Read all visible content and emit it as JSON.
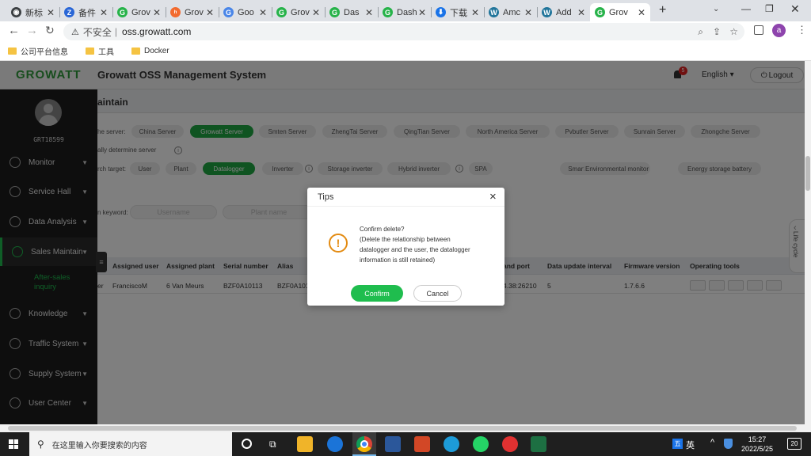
{
  "browser": {
    "tabs": [
      {
        "label": "新标",
        "color": "#3c4043",
        "glyph": "◉"
      },
      {
        "label": "备件",
        "color": "#2966d6",
        "glyph": "Z"
      },
      {
        "label": "Grov",
        "color": "#27b34a",
        "glyph": "G"
      },
      {
        "label": "Grov",
        "color": "#f26a2e",
        "glyph": "ʰ"
      },
      {
        "label": "Goo",
        "color": "#4a86e8",
        "glyph": "G"
      },
      {
        "label": "Grov",
        "color": "#27b34a",
        "glyph": "G"
      },
      {
        "label": "Das",
        "color": "#27b34a",
        "glyph": "G"
      },
      {
        "label": "Dash",
        "color": "#27b34a",
        "glyph": "G"
      },
      {
        "label": "下载",
        "color": "#1a73e8",
        "glyph": "⬇"
      },
      {
        "label": "Amc",
        "color": "#21759b",
        "glyph": "W"
      },
      {
        "label": "Add",
        "color": "#21759b",
        "glyph": "W"
      },
      {
        "label": "Grov",
        "color": "#27b34a",
        "glyph": "G"
      }
    ],
    "new_tab": "+",
    "security_label": "不安全",
    "url": "oss.growatt.com",
    "profile_initial": "a",
    "bookmarks": [
      "公司平台信息",
      "工具",
      "Docker"
    ]
  },
  "app": {
    "logo": "GROWATT",
    "title": "Growatt OSS Management System",
    "notification_count": "5",
    "language": "English",
    "logout": "Logout",
    "username": "GRT18599",
    "side_tab": "Life cycle"
  },
  "sidebar": {
    "items": [
      {
        "label": "Monitor",
        "caret": true
      },
      {
        "label": "Service Hall",
        "caret": true
      },
      {
        "label": "Data Analysis",
        "caret": true
      },
      {
        "label": "Sales Maintain",
        "caret": true
      },
      {
        "label": "Knowledge",
        "caret": true
      },
      {
        "label": "Traffic System",
        "caret": true
      },
      {
        "label": "Supply System",
        "caret": true
      },
      {
        "label": "User Center",
        "caret": true
      }
    ],
    "sub_item": "After-sales inquiry"
  },
  "page": {
    "title": "aintain",
    "server_label": "he server:",
    "servers": [
      "China Server",
      "Growatt Server",
      "Smten Server",
      "ZhengTai Server",
      "QingTian Server",
      "North America Server",
      "Pvbutler Server",
      "Sunrain Server",
      "Zhongche Server"
    ],
    "auto_server": "ally determine server",
    "target_label": "rch target:",
    "targets": [
      "User",
      "Plant",
      "Datalogger",
      "Inverter",
      "Storage inverter",
      "Hybrid inverter",
      "SPA",
      "Smart electric meter",
      "Environmental monitor",
      "Energy storage battery"
    ],
    "keyword_label": "n keyword:",
    "username_placeholder": "Username",
    "plant_placeholder": "Plant name",
    "table": {
      "headers": [
        "Assigned user",
        "Assigned plant",
        "Serial number",
        "Alias",
        "and port",
        "Data update interval",
        "Firmware version",
        "Operating tools"
      ],
      "row": [
        "er",
        "FranciscoM",
        "6 Van Meurs",
        "BZF0A10113",
        "BZF0A101",
        "4.38:26210",
        "5",
        "1.7.6.6"
      ]
    }
  },
  "dialog": {
    "title": "Tips",
    "close": "×",
    "message": [
      "Confirm delete?",
      "(Delete the relationship between",
      "datalogger and the user, the datalogger",
      "information is still retained)"
    ],
    "confirm": "Confirm",
    "cancel": "Cancel"
  },
  "taskbar": {
    "search_placeholder": "在这里输入你要搜索的内容",
    "ime": "英",
    "ime_badge": "五",
    "time": "15:27",
    "date": "2022/5/25",
    "notification_count": "20"
  },
  "colors": {
    "accent": "#1fbd4e",
    "warning": "#e38b12",
    "sidebar_bg": "#1c1c1c"
  }
}
